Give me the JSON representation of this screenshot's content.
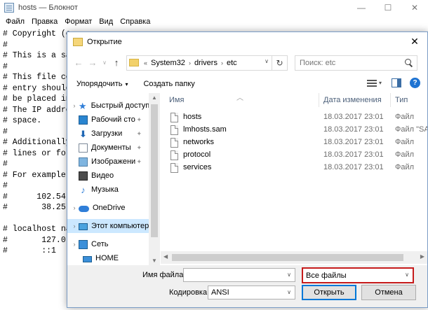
{
  "notepad": {
    "title": "hosts — Блокнот",
    "window_buttons": [
      "—",
      "☐",
      "✕"
    ],
    "menu": [
      "Файл",
      "Правка",
      "Формат",
      "Вид",
      "Справка"
    ],
    "lines": [
      "# Copyright (c",
      "#",
      "# This is a sa",
      "#",
      "# This file co",
      "# entry should",
      "# be placed in",
      "# The IP addre",
      "# space.",
      "#",
      "# Additionally",
      "# lines or fol",
      "#",
      "# For example:",
      "#",
      "#      102.54.",
      "#       38.25.",
      "",
      "# localhost na",
      "#       127.0.",
      "#       ::1"
    ]
  },
  "dialog": {
    "title": "Открытие",
    "close_glyph": "✕",
    "nav": {
      "back": "←",
      "forward": "→",
      "history": "∨",
      "up": "↑"
    },
    "address": {
      "prefix": "«",
      "segments": [
        "System32",
        "drivers",
        "etc"
      ],
      "separator": "›",
      "dropdown": "∨",
      "refresh": "↻"
    },
    "search": {
      "placeholder": "Поиск: etc"
    },
    "toolbar": {
      "organize": "Упорядочить",
      "organize_dd": "▾",
      "new_folder": "Создать папку",
      "view_dd": "▾",
      "help": "?"
    },
    "nav_pane": [
      {
        "label": "Быстрый доступ",
        "icon": "star-icon",
        "expand": "›",
        "pin": ""
      },
      {
        "label": "Рабочий сто",
        "icon": "desktop-icon",
        "expand": "",
        "pin": "✦"
      },
      {
        "label": "Загрузки",
        "icon": "download-icon",
        "expand": "",
        "pin": "✦"
      },
      {
        "label": "Документы",
        "icon": "documents-icon",
        "expand": "",
        "pin": "✦"
      },
      {
        "label": "Изображени",
        "icon": "pictures-icon",
        "expand": "",
        "pin": "✦"
      },
      {
        "label": "Видео",
        "icon": "video-icon",
        "expand": "",
        "pin": ""
      },
      {
        "label": "Музыка",
        "icon": "music-icon",
        "expand": "",
        "pin": ""
      },
      {
        "label": "OneDrive",
        "icon": "onedrive-icon",
        "expand": "›",
        "pin": ""
      },
      {
        "label": "Этот компьютер",
        "icon": "computer-icon",
        "expand": "›",
        "pin": "",
        "selected": true
      },
      {
        "label": "Сеть",
        "icon": "network-icon",
        "expand": "›",
        "pin": ""
      },
      {
        "label": "HOME",
        "icon": "home-computer-icon",
        "expand": "",
        "pin": ""
      }
    ],
    "scroll": {
      "up": "▲",
      "down": "▼",
      "left": "◀",
      "right": "▶",
      "sort": "︿"
    },
    "columns": {
      "name": "Имя",
      "date": "Дата изменения",
      "type": "Тип"
    },
    "files": [
      {
        "name": "hosts",
        "date": "18.03.2017 23:01",
        "type": "Файл"
      },
      {
        "name": "lmhosts.sam",
        "date": "18.03.2017 23:01",
        "type": "Файл \"SA"
      },
      {
        "name": "networks",
        "date": "18.03.2017 23:01",
        "type": "Файл"
      },
      {
        "name": "protocol",
        "date": "18.03.2017 23:01",
        "type": "Файл"
      },
      {
        "name": "services",
        "date": "18.03.2017 23:01",
        "type": "Файл"
      }
    ],
    "bottom": {
      "filename_label": "Имя файла:",
      "filename_value": "",
      "filetype_value": "Все файлы",
      "encoding_label": "Кодировка:",
      "encoding_value": "ANSI",
      "dropdown": "∨",
      "open": "Открыть",
      "cancel": "Отмена"
    },
    "colors": {
      "highlight": "#c61b1b",
      "selection": "#cce8ff",
      "accent": "#0078d7"
    }
  }
}
